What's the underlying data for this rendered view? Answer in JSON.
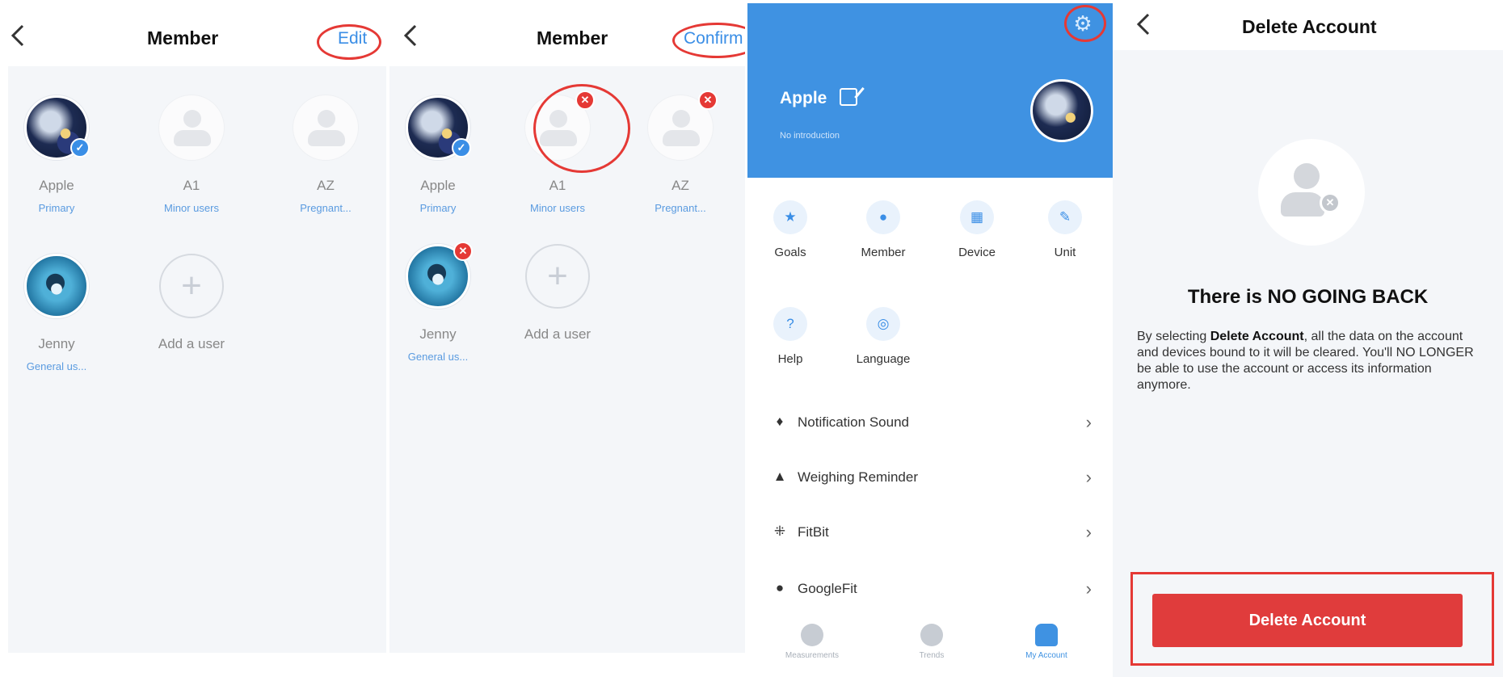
{
  "screen1": {
    "title": "Member",
    "action": "Edit",
    "members": [
      {
        "name": "Apple",
        "role": "Primary"
      },
      {
        "name": "A1",
        "role": "Minor users"
      },
      {
        "name": "AZ",
        "role": "Pregnant..."
      },
      {
        "name": "Jenny",
        "role": "General us..."
      }
    ],
    "add_label": "Add a user"
  },
  "screen2": {
    "title": "Member",
    "action": "Confirm",
    "members": [
      {
        "name": "Apple",
        "role": "Primary"
      },
      {
        "name": "A1",
        "role": "Minor users"
      },
      {
        "name": "AZ",
        "role": "Pregnant..."
      },
      {
        "name": "Jenny",
        "role": "General us..."
      }
    ],
    "add_label": "Add a user"
  },
  "screen3": {
    "name": "Apple",
    "intro": "No introduction",
    "grid": [
      {
        "label": "Goals",
        "icon": "star-icon"
      },
      {
        "label": "Member",
        "icon": "members-icon"
      },
      {
        "label": "Device",
        "icon": "device-grid-icon"
      },
      {
        "label": "Unit",
        "icon": "ruler-icon"
      },
      {
        "label": "Help",
        "icon": "help-icon"
      },
      {
        "label": "Language",
        "icon": "globe-icon"
      }
    ],
    "menu": [
      {
        "label": "Notification Sound",
        "icon": "microphone-icon"
      },
      {
        "label": "Weighing Reminder",
        "icon": "bell-icon"
      },
      {
        "label": "FitBit",
        "icon": "fitbit-icon"
      },
      {
        "label": "GoogleFit",
        "icon": "googlefit-icon"
      }
    ],
    "tabs": [
      {
        "label": "Measurements"
      },
      {
        "label": "Trends"
      },
      {
        "label": "My Account"
      }
    ],
    "accent": "#3f92e2"
  },
  "screen4": {
    "title": "Delete Account",
    "heading": "There is NO GOING BACK",
    "text_pre": "By selecting ",
    "text_bold": "Delete Account",
    "text_post": ", all the data on the account and devices bound to it will be cleared. You'll NO LONGER be able to use the account or access its information anymore.",
    "button": "Delete Account",
    "danger_color": "#e03c3c"
  }
}
